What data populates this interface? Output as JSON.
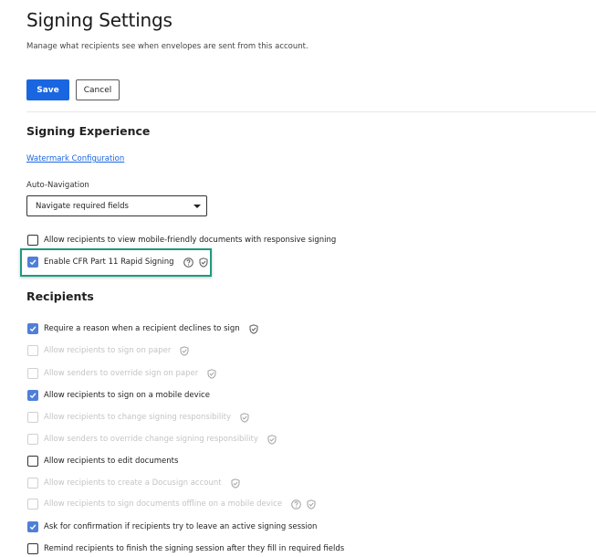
{
  "page": {
    "title": "Signing Settings",
    "subtitle": "Manage what recipients see when envelopes are sent from this account."
  },
  "actions": {
    "save_label": "Save",
    "cancel_label": "Cancel"
  },
  "colors": {
    "primary": "#1a66e0",
    "checkbox_checked": "#4f7fd9",
    "highlight": "#1d9a83",
    "disabled_text": "#c4c4c4"
  },
  "signing_experience": {
    "title": "Signing Experience",
    "watermark_link": "Watermark Configuration",
    "auto_navigation": {
      "label": "Auto-Navigation",
      "selected": "Navigate required fields"
    },
    "options": [
      {
        "label": "Allow recipients to view mobile-friendly documents with responsive signing",
        "checked": false,
        "disabled": false,
        "icons": []
      },
      {
        "label": "Enable CFR Part 11 Rapid Signing",
        "checked": true,
        "disabled": false,
        "icons": [
          "help-icon",
          "shield-check-icon"
        ],
        "highlighted": true
      }
    ]
  },
  "recipients": {
    "title": "Recipients",
    "options": [
      {
        "label": "Require a reason when a recipient declines to sign",
        "checked": true,
        "disabled": false,
        "icons": [
          "shield-check-icon"
        ]
      },
      {
        "label": "Allow recipients to sign on paper",
        "checked": false,
        "disabled": true,
        "icons": [
          "shield-check-icon"
        ]
      },
      {
        "label": "Allow senders to override sign on paper",
        "checked": false,
        "disabled": true,
        "icons": [
          "shield-check-icon"
        ]
      },
      {
        "label": "Allow recipients to sign on a mobile device",
        "checked": true,
        "disabled": false,
        "icons": []
      },
      {
        "label": "Allow recipients to change signing responsibility",
        "checked": false,
        "disabled": true,
        "icons": [
          "shield-check-icon"
        ]
      },
      {
        "label": "Allow senders to override change signing responsibility",
        "checked": false,
        "disabled": true,
        "icons": [
          "shield-check-icon"
        ]
      },
      {
        "label": "Allow recipients to edit documents",
        "checked": false,
        "disabled": false,
        "icons": []
      },
      {
        "label": "Allow recipients to create a Docusign account",
        "checked": false,
        "disabled": true,
        "icons": [
          "shield-check-icon"
        ]
      },
      {
        "label": "Allow recipients to sign documents offline on a mobile device",
        "checked": false,
        "disabled": true,
        "icons": [
          "help-icon",
          "shield-check-icon"
        ]
      },
      {
        "label": "Ask for confirmation if recipients try to leave an active signing session",
        "checked": true,
        "disabled": false,
        "icons": []
      },
      {
        "label": "Remind recipients to finish the signing session after they fill in required fields",
        "checked": false,
        "disabled": false,
        "icons": []
      }
    ]
  }
}
